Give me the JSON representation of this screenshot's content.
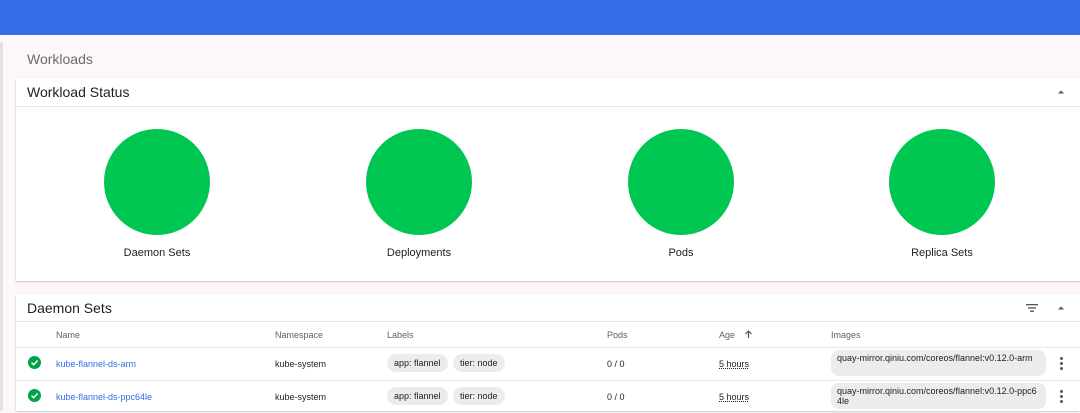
{
  "page": {
    "title": "Workloads"
  },
  "workload_status": {
    "title": "Workload Status",
    "items": [
      {
        "label": "Daemon Sets",
        "color": "#00c752"
      },
      {
        "label": "Deployments",
        "color": "#00c752"
      },
      {
        "label": "Pods",
        "color": "#00c752"
      },
      {
        "label": "Replica Sets",
        "color": "#00c752"
      }
    ]
  },
  "daemon_sets": {
    "title": "Daemon Sets",
    "columns": {
      "name": "Name",
      "namespace": "Namespace",
      "labels": "Labels",
      "pods": "Pods",
      "age": "Age",
      "images": "Images"
    },
    "sort_icon": "arrow-up-icon",
    "rows": [
      {
        "status": "check-circle-icon",
        "name": "kube-flannel-ds-arm",
        "namespace": "kube-system",
        "labels": [
          "app: flannel",
          "tier: node"
        ],
        "pods": "0 / 0",
        "age": "5 hours",
        "image": "quay-mirror.qiniu.com/coreos/flannel:v0.12.0-arm"
      },
      {
        "status": "check-circle-icon",
        "name": "kube-flannel-ds-ppc64le",
        "namespace": "kube-system",
        "labels": [
          "app: flannel",
          "tier: node"
        ],
        "pods": "0 / 0",
        "age": "5 hours",
        "image": "quay-mirror.qiniu.com/coreos/flannel:v0.12.0-ppc64le"
      }
    ]
  },
  "colors": {
    "brand": "#326de6",
    "success": "#00c752",
    "link": "#326de6"
  }
}
